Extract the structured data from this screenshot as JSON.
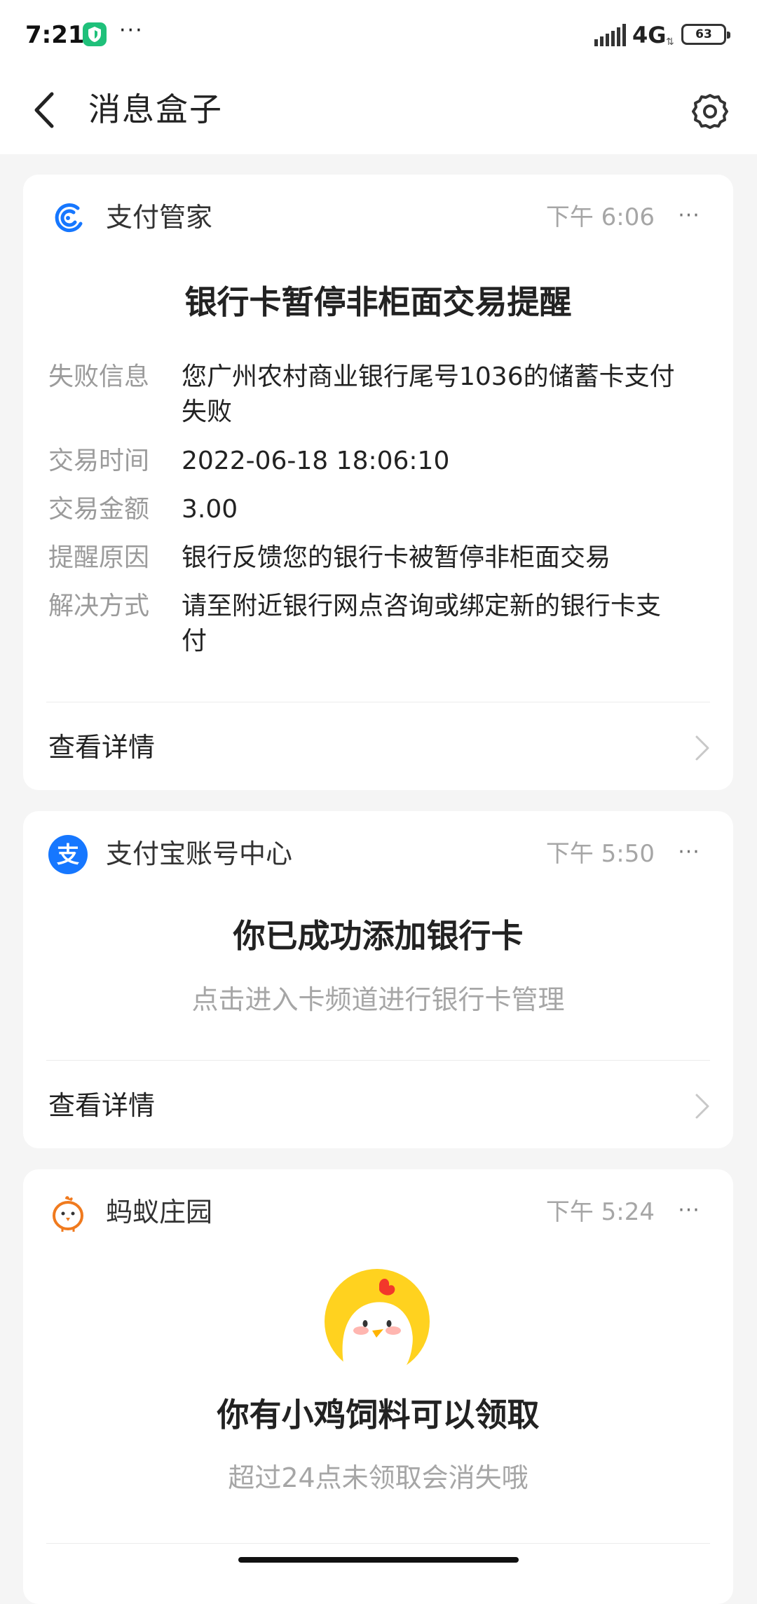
{
  "status_bar": {
    "time": "7:21",
    "app_icon": "shield-app-icon",
    "overflow": "···",
    "network": "4G",
    "battery": "63"
  },
  "nav": {
    "title": "消息盒子",
    "back_icon": "chevron-left-icon",
    "settings_icon": "gear-icon"
  },
  "colors": {
    "background": "#f5f5f5",
    "card": "#ffffff",
    "accent_blue": "#1677ff",
    "muted_text": "#a6a6a6",
    "chick_orange": "#f07a1e"
  },
  "cards": [
    {
      "source": "支付管家",
      "icon": "payment-manager-icon",
      "time": "下午 6:06",
      "title": "银行卡暂停非柜面交易提醒",
      "rows": [
        {
          "label": "失败信息",
          "value_line1": "您广州农村商业银行尾号1036的储蓄卡支付",
          "value_line2": "失败"
        },
        {
          "label": "交易时间",
          "value_line1": "2022-06-18 18:06:10"
        },
        {
          "label": "交易金额",
          "value_line1": "3.00"
        },
        {
          "label": "提醒原因",
          "value_line1": "银行反馈您的银行卡被暂停非柜面交易"
        },
        {
          "label": "解决方式",
          "value_line1": "请至附近银行网点咨询或绑定新的银行卡支",
          "value_line2": "付"
        }
      ],
      "detail_label": "查看详情"
    },
    {
      "source": "支付宝账号中心",
      "icon": "alipay-icon",
      "time": "下午 5:50",
      "title": "你已成功添加银行卡",
      "subtitle": "点击进入卡频道进行银行卡管理",
      "detail_label": "查看详情"
    },
    {
      "source": "蚂蚁庄园",
      "icon": "chick-icon",
      "time": "下午 5:24",
      "title": "你有小鸡饲料可以领取",
      "subtitle": "超过24点未领取会消失哦"
    }
  ]
}
